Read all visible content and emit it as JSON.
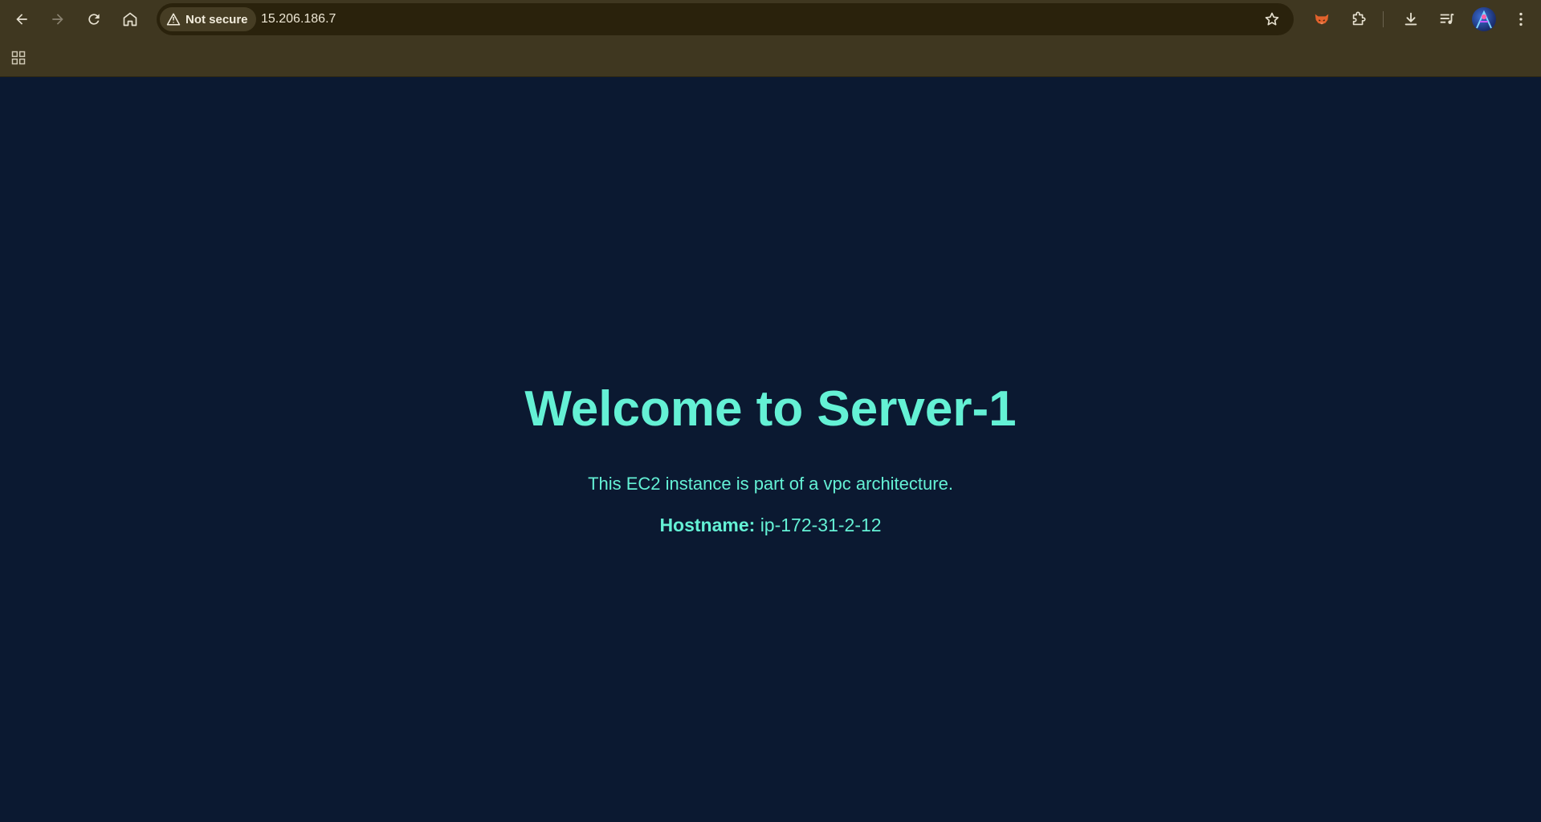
{
  "browser": {
    "url": "15.206.186.7",
    "security_label": "Not secure",
    "toolbar_color": "#3f3720",
    "omnibox_color": "#2a220c",
    "icons": [
      "back-icon",
      "forward-icon",
      "reload-icon",
      "home-icon",
      "warning-icon",
      "star-icon",
      "fox-extension-icon",
      "puzzle-icon",
      "download-icon",
      "media-playlist-icon",
      "menu-icon",
      "apps-grid-icon"
    ]
  },
  "page": {
    "background": "#0b1931",
    "accent": "#64f1d5",
    "heading": "Welcome to Server-1",
    "description": "This EC2 instance is part of a vpc architecture.",
    "hostname_label": "Hostname:",
    "hostname_value": "ip-172-31-2-12"
  }
}
